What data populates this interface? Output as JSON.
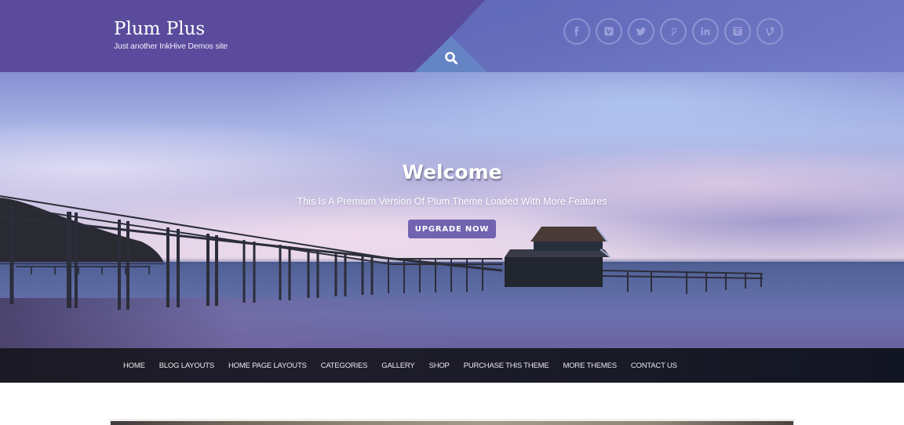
{
  "header": {
    "site_title": "Plum Plus",
    "tagline": "Just another InkHive Demos site",
    "search_icon": "search-icon",
    "social_links": [
      {
        "name": "facebook",
        "icon": "facebook-icon"
      },
      {
        "name": "vimeo",
        "icon": "vimeo-icon"
      },
      {
        "name": "twitter",
        "icon": "twitter-icon"
      },
      {
        "name": "pinterest",
        "icon": "pinterest-icon"
      },
      {
        "name": "linkedin",
        "icon": "linkedin-icon"
      },
      {
        "name": "instagram",
        "icon": "instagram-icon"
      },
      {
        "name": "vine",
        "icon": "vine-icon"
      }
    ]
  },
  "hero": {
    "title": "Welcome",
    "subtitle": "This Is A Premium Version Of Plum Theme Loaded With More Features",
    "button_label": "UPGRADE NOW"
  },
  "nav": {
    "items": [
      {
        "label": "HOME"
      },
      {
        "label": "BLOG LAYOUTS"
      },
      {
        "label": "HOME PAGE LAYOUTS"
      },
      {
        "label": "CATEGORIES"
      },
      {
        "label": "GALLERY"
      },
      {
        "label": "SHOP"
      },
      {
        "label": "PURCHASE THIS THEME"
      },
      {
        "label": "MORE THEMES"
      },
      {
        "label": "CONTACT US"
      }
    ]
  },
  "colors": {
    "brand_purple": "#5b4b9d",
    "search_triangle": "#6484c4",
    "button": "#7263b0",
    "nav_background": "#1b1a24"
  }
}
